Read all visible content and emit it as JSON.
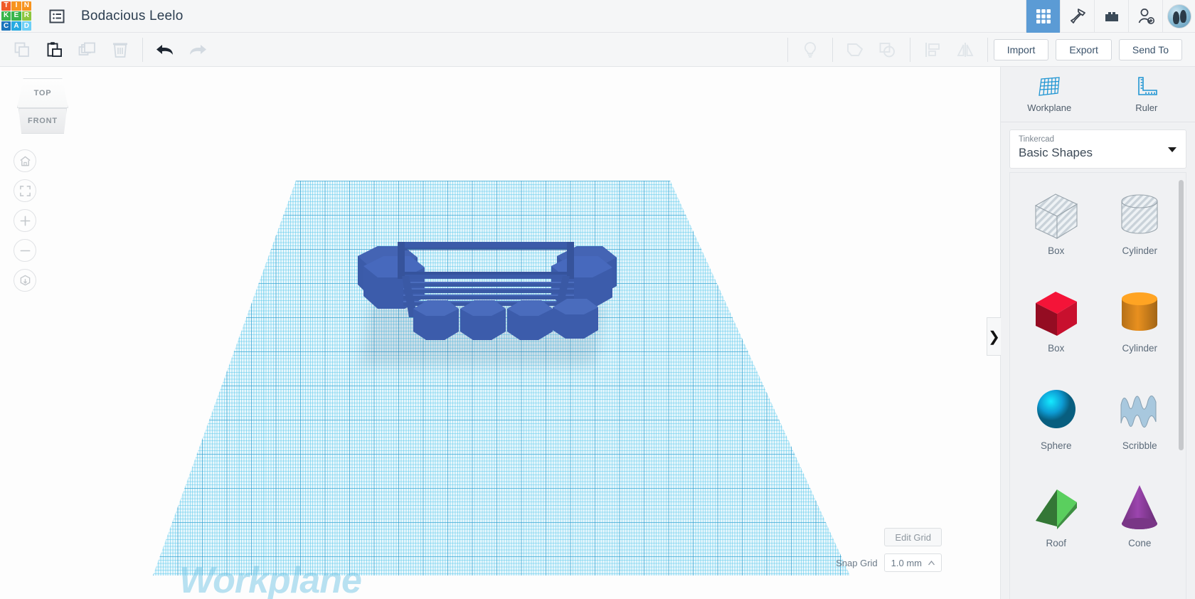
{
  "app": {
    "logo_tiles": [
      {
        "letter": "T",
        "color": "#f05a28"
      },
      {
        "letter": "I",
        "color": "#f7941e"
      },
      {
        "letter": "N",
        "color": "#f7941e"
      },
      {
        "letter": "K",
        "color": "#39b54a"
      },
      {
        "letter": "E",
        "color": "#39b54a"
      },
      {
        "letter": "R",
        "color": "#8dc63f"
      },
      {
        "letter": "C",
        "color": "#1c75bc"
      },
      {
        "letter": "A",
        "color": "#27aae1"
      },
      {
        "letter": "D",
        "color": "#6dcff6"
      }
    ],
    "document_title": "Bodacious Leelo",
    "doclist_icon": "list-icon",
    "accent_color": "#5b9bd5"
  },
  "topbar_right": {
    "icons": [
      {
        "name": "grid-view-icon",
        "active": true
      },
      {
        "name": "hammer-icon",
        "active": false
      },
      {
        "name": "blocks-icon",
        "active": false
      },
      {
        "name": "add-person-icon",
        "active": false
      }
    ],
    "avatar_name": "user-avatar"
  },
  "toolbar": {
    "left_tools": [
      {
        "name": "copy-icon",
        "label": "Copy",
        "enabled": false
      },
      {
        "name": "paste-icon",
        "label": "Paste",
        "enabled": true
      },
      {
        "name": "duplicate-icon",
        "label": "Duplicate",
        "enabled": false
      },
      {
        "name": "delete-icon",
        "label": "Delete",
        "enabled": false
      }
    ],
    "history_tools": [
      {
        "name": "undo-icon",
        "label": "Undo",
        "enabled": true
      },
      {
        "name": "redo-icon",
        "label": "Redo",
        "enabled": false
      }
    ],
    "right_tools": [
      {
        "name": "lightbulb-icon",
        "label": "Notes",
        "enabled": false
      },
      {
        "name": "group-icon",
        "label": "Group",
        "enabled": false
      },
      {
        "name": "ungroup-icon",
        "label": "Ungroup",
        "enabled": false
      },
      {
        "name": "align-icon",
        "label": "Align",
        "enabled": false
      },
      {
        "name": "mirror-icon",
        "label": "Mirror",
        "enabled": false
      }
    ],
    "buttons": [
      {
        "name": "import-button",
        "label": "Import"
      },
      {
        "name": "export-button",
        "label": "Export"
      },
      {
        "name": "sendto-button",
        "label": "Send To"
      }
    ]
  },
  "canvas": {
    "view_cube": {
      "top_label": "TOP",
      "front_label": "FRONT"
    },
    "view_buttons": [
      {
        "name": "home-view-button",
        "icon": "home-icon"
      },
      {
        "name": "fit-view-button",
        "icon": "fit-frame-icon"
      },
      {
        "name": "zoom-in-button",
        "icon": "plus-icon"
      },
      {
        "name": "zoom-out-button",
        "icon": "minus-icon"
      },
      {
        "name": "projection-toggle-button",
        "icon": "cube-projection-icon"
      }
    ],
    "workplane_label": "Workplane",
    "workplane_color": "#e9f7fc",
    "model_color": "#3b5ba9",
    "edit_grid_label": "Edit Grid",
    "snap_grid_label": "Snap Grid",
    "snap_grid_value": "1.0 mm"
  },
  "right_panel": {
    "tools": [
      {
        "name": "workplane-tool",
        "label": "Workplane",
        "icon": "workplane-grid-icon"
      },
      {
        "name": "ruler-tool",
        "label": "Ruler",
        "icon": "ruler-icon"
      }
    ],
    "library_source": "Tinkercad",
    "library_name": "Basic Shapes",
    "collapse_label": "❯",
    "shapes": [
      {
        "name": "shape-box-hole",
        "label": "Box",
        "style": "hole-box"
      },
      {
        "name": "shape-cylinder-hole",
        "label": "Cylinder",
        "style": "hole-cylinder"
      },
      {
        "name": "shape-box-red",
        "label": "Box",
        "style": "solid-box",
        "color": "#c8102e"
      },
      {
        "name": "shape-cylinder-orange",
        "label": "Cylinder",
        "style": "solid-cylinder",
        "color": "#e8901f"
      },
      {
        "name": "shape-sphere",
        "label": "Sphere",
        "style": "sphere",
        "color": "#0d9cd4"
      },
      {
        "name": "shape-scribble",
        "label": "Scribble",
        "style": "scribble",
        "color": "#a8c8de"
      },
      {
        "name": "shape-roof",
        "label": "Roof",
        "style": "roof",
        "color": "#4caf50"
      },
      {
        "name": "shape-cone",
        "label": "Cone",
        "style": "cone",
        "color": "#8e3f9e"
      }
    ]
  }
}
